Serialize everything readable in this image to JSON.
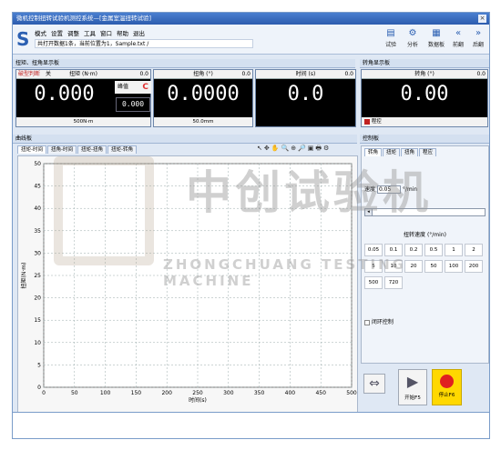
{
  "window": {
    "title": "微机控制扭转试验机测控系统—[金属室温扭转试验]",
    "close_glyph": "×"
  },
  "menu": {
    "items": [
      "模式",
      "设置",
      "调整",
      "工具",
      "窗口",
      "帮助",
      "退出"
    ],
    "status": "共打开数据1条，当前位置为1，Sample.txt /"
  },
  "toolbar": [
    {
      "label": "试验",
      "icon": "doc-icon",
      "glyph": "▤"
    },
    {
      "label": "分析",
      "icon": "analysis-icon",
      "glyph": "⚙"
    },
    {
      "label": "数据板",
      "icon": "databoard-icon",
      "glyph": "▦"
    },
    {
      "label": "前翻",
      "icon": "prev-icon",
      "glyph": "«"
    },
    {
      "label": "后翻",
      "icon": "next-icon",
      "glyph": "»"
    }
  ],
  "display_panel": {
    "header": "扭矩、扭角显示板",
    "break_label": "破型判断",
    "break_value": "关",
    "torque": {
      "label": "扭矩 (N·m)",
      "unit_tag": "0.0",
      "value": "0.000",
      "footer": "500N·m"
    },
    "peak": {
      "label": "峰值",
      "value": "0.000",
      "reset_glyph": "C"
    },
    "angle": {
      "label": "扭角 (°)",
      "unit_tag": "0.0",
      "value": "0.0000",
      "footer": "50.0mm"
    },
    "time": {
      "label": "时间 (s)",
      "unit_tag": "0.0",
      "value": "0.0"
    }
  },
  "speed_panel": {
    "header": "转角显示板",
    "speed": {
      "label": "转角 (°)",
      "unit_tag": "0.0",
      "value": "0.00"
    },
    "control_label": "程控"
  },
  "curve_panel": {
    "header": "曲线板",
    "tabs": [
      "扭矩-时间",
      "扭角-时间",
      "扭矩-扭角",
      "扭矩-转角"
    ],
    "tool_glyphs": [
      "↖",
      "✥",
      "✋",
      "🔍",
      "⊕",
      "🔎",
      "▣",
      "🖶",
      "⚙"
    ]
  },
  "control_panel": {
    "header": "控制板",
    "tabs": [
      "转角",
      "扭矩",
      "扭角",
      "程应"
    ],
    "speed_label": "速度",
    "speed_value": "0.05",
    "speed_unit": "°/min",
    "preset_title": "扭转速度 (°/min)",
    "presets": [
      "0.05",
      "0.1",
      "0.2",
      "0.5",
      "1",
      "2",
      "5",
      "10",
      "20",
      "50",
      "100",
      "200",
      "500",
      "720"
    ],
    "closed_loop_label": "闭环控制",
    "start_label": "开始F5",
    "stop_label": "停止F6"
  },
  "watermark": {
    "cn": "中创试验机",
    "en": "ZHONGCHUANG TESTING MACHINE"
  },
  "chart_data": {
    "type": "line",
    "xlabel": "时间(s)",
    "ylabel": "扭矩(N·m)",
    "xlim": [
      0,
      500
    ],
    "ylim": [
      0,
      50
    ],
    "xticks": [
      0,
      50,
      100,
      150,
      200,
      250,
      300,
      350,
      400,
      450,
      500
    ],
    "yticks": [
      0,
      5,
      10,
      15,
      20,
      25,
      30,
      35,
      40,
      45,
      50
    ],
    "grid": true,
    "series": []
  },
  "colors": {
    "accent": "#2b5fb2",
    "display_bg": "#000000",
    "stop": "#ffd800",
    "stop_dot": "#e02020",
    "control": "#c02020"
  }
}
